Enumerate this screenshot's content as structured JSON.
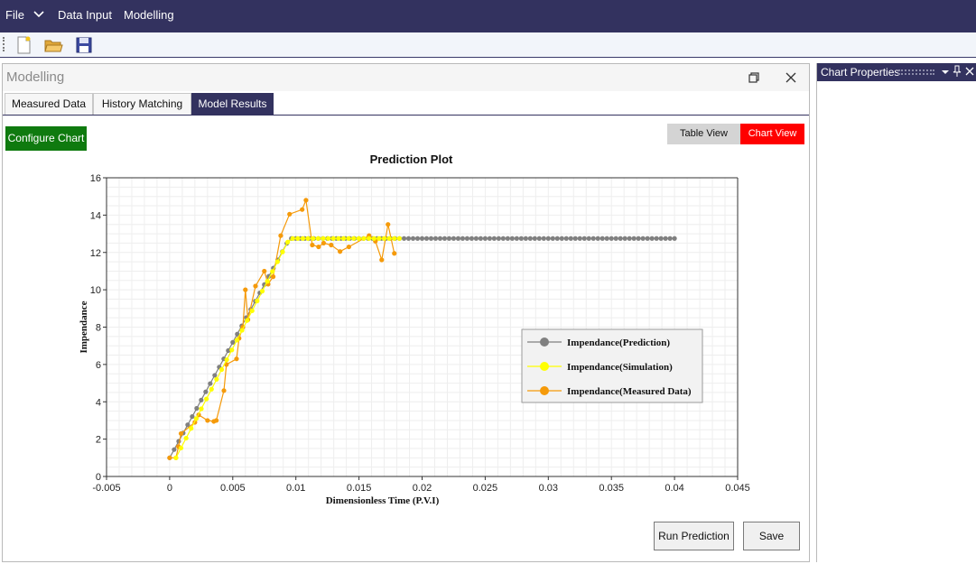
{
  "menubar": {
    "file": "File",
    "data_input": "Data Input",
    "modelling": "Modelling"
  },
  "toolbar": {
    "icons": [
      "new-file-icon",
      "open-folder-icon",
      "save-icon"
    ]
  },
  "main_panel": {
    "title": "Modelling",
    "tabs": [
      {
        "label": "Measured Data",
        "active": false
      },
      {
        "label": "History Matching",
        "active": false
      },
      {
        "label": "Model Results",
        "active": true
      }
    ],
    "configure_label": "Configure Chart",
    "table_view_label": "Table View",
    "chart_view_label": "Chart View",
    "run_label": "Run Prediction",
    "save_label": "Save"
  },
  "right_panel": {
    "title": "Chart Properties"
  },
  "colors": {
    "menubar": "#33325f",
    "configure": "#0f7a0f",
    "chart_view": "#ff0000",
    "prediction": "#808080",
    "simulation": "#ffff00",
    "measured": "#f59a0a"
  },
  "chart_data": {
    "type": "line",
    "title": "Prediction Plot",
    "xlabel": "Dimensionless Time (P.V.I)",
    "ylabel": "Impendance",
    "xlim": [
      -0.005,
      0.045
    ],
    "ylim": [
      0,
      16
    ],
    "xticks": [
      "-0.005",
      "0",
      "0.005",
      "0.01",
      "0.015",
      "0.02",
      "0.025",
      "0.03",
      "0.035",
      "0.04",
      "0.045"
    ],
    "yticks": [
      "0",
      "2",
      "4",
      "6",
      "8",
      "10",
      "12",
      "14",
      "16"
    ],
    "grid": true,
    "legend_position": "right",
    "series": [
      {
        "name": "Impendance(Prediction)",
        "color": "#808080",
        "x_start": 0.0,
        "x_end": 0.04,
        "ramp_end_x": 0.0095,
        "y_start": 1.0,
        "y_plateau": 12.75,
        "count": 113
      },
      {
        "name": "Impendance(Simulation)",
        "color": "#ffff00",
        "x_start": 0.0005,
        "x_end": 0.0182,
        "ramp_end_x": 0.0095,
        "y_start": 1.0,
        "y_plateau": 12.75,
        "count": 45
      },
      {
        "name": "Impendance(Measured Data)",
        "color": "#f59a0a",
        "x": [
          0.0,
          0.0005,
          0.0007,
          0.0009,
          0.002,
          0.0023,
          0.003,
          0.0035,
          0.0037,
          0.0043,
          0.0045,
          0.0053,
          0.0055,
          0.0058,
          0.006,
          0.0062,
          0.0068,
          0.0075,
          0.0078,
          0.0082,
          0.0088,
          0.0095,
          0.0105,
          0.0108,
          0.0113,
          0.0118,
          0.0122,
          0.0128,
          0.0135,
          0.0142,
          0.0158,
          0.0163,
          0.0168,
          0.0173,
          0.0178
        ],
        "y": [
          1.0,
          1.0,
          1.6,
          2.3,
          2.9,
          3.3,
          3.0,
          2.95,
          3.0,
          4.6,
          6.0,
          6.3,
          7.4,
          8.0,
          10.0,
          8.4,
          10.2,
          11.0,
          10.3,
          10.7,
          12.9,
          14.05,
          14.3,
          14.8,
          12.4,
          12.3,
          12.5,
          12.4,
          12.05,
          12.3,
          12.9,
          12.6,
          11.6,
          13.5,
          11.95
        ]
      }
    ]
  }
}
